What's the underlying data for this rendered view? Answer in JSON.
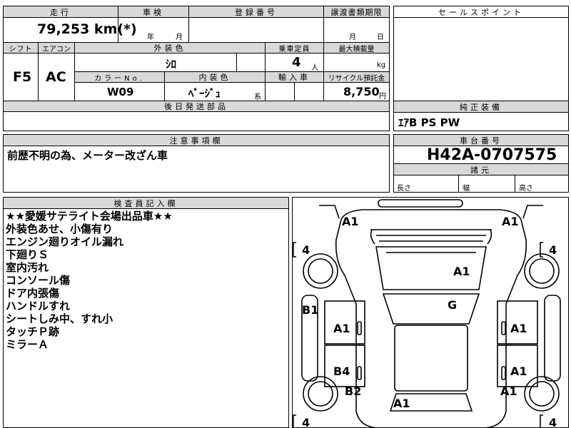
{
  "spec": {
    "mileage_label": "走行",
    "mileage_value": "79,253 km(*)",
    "inspection_label": "車検",
    "inspection_year": "年",
    "inspection_month": "月",
    "registration_label": "登録番号",
    "transfer_docs_label": "譲渡書類期限",
    "transfer_month": "月",
    "transfer_day": "日",
    "shift_label": "シフト",
    "shift_value": "F5",
    "aircon_label": "エアコン",
    "aircon_value": "AC",
    "exterior_color_label": "外装色",
    "exterior_color_value": "ｼﾛ",
    "capacity_label": "乗車定員",
    "capacity_value": "4",
    "capacity_unit": "人",
    "max_load_label": "最大積載量",
    "max_load_unit": "kg",
    "color_no_label": "カラーNo.",
    "color_no_value": "W09",
    "interior_color_label": "内装色",
    "interior_color_value": "ﾍﾞｰｼﾞｭ",
    "interior_color_suffix": "系",
    "import_label": "輸入車",
    "recycle_label": "リサイクル預託金",
    "recycle_value": "8,750",
    "recycle_unit": "円",
    "later_parts_label": "後日発送部品"
  },
  "sales_point": {
    "label": "セールスポイント"
  },
  "genuine_equipment": {
    "label": "純正装備",
    "value": "ｴｱB PS PW"
  },
  "notes": {
    "label": "注意事項欄",
    "text": "前歴不明の為、メーター改ざん車"
  },
  "chassis": {
    "label": "車台番号",
    "value": "H42A-0707575"
  },
  "dimensions": {
    "label": "諸元",
    "length": "長さ",
    "width": "幅",
    "height": "高さ"
  },
  "inspector": {
    "label": "検査員記入欄",
    "lines": [
      "★★愛媛サテライト会場出品車★★",
      "外装色あせ、小傷有り",
      "エンジン廻りオイル漏れ",
      "下廻りＳ",
      "室内汚れ",
      "コンソール傷",
      "ドア内張傷",
      "ハンドルすれ",
      "シートしみ中、すれ小",
      "タッチＰ跡",
      "ミラーＡ"
    ]
  },
  "diagram": {
    "tire_fl": "4",
    "tire_fr": "4",
    "tire_rl": "4",
    "tire_rr": "4",
    "marks": {
      "front_left": "A1",
      "front_right": "A1",
      "hood": "A1",
      "windshield": "G",
      "left_pillar": "B1",
      "left_front_door": "A1",
      "right_front_door": "A1",
      "left_rear_door": "B4",
      "right_rear_door": "A1",
      "left_rear_fender": "B2",
      "right_rear_fender": "A1",
      "rear": "A1"
    }
  }
}
